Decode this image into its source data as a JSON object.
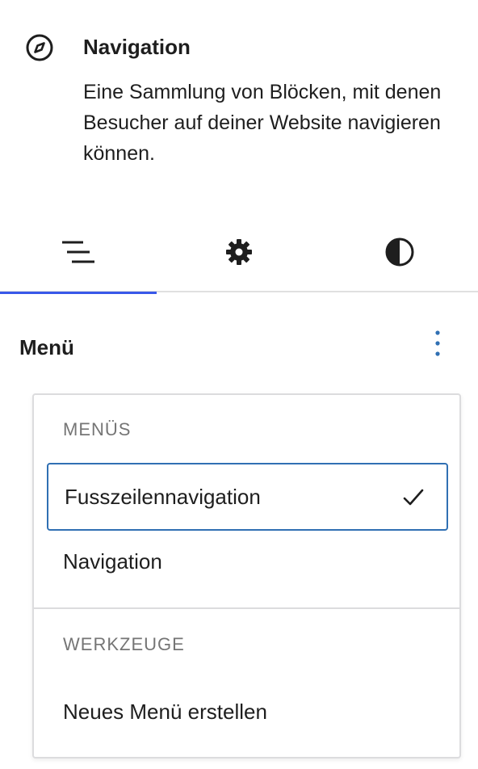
{
  "block": {
    "icon": "compass-icon",
    "title": "Navigation",
    "description": "Eine Sammlung von Blöcken, mit denen Besucher auf deiner Website navigieren können."
  },
  "tabs": [
    {
      "icon": "list-view-icon",
      "active": true
    },
    {
      "icon": "gear-icon",
      "active": false
    },
    {
      "icon": "contrast-icon",
      "active": false
    }
  ],
  "menu": {
    "title": "Menü",
    "options_icon": "more-vertical-icon"
  },
  "dropdown": {
    "menus_label": "MENÜS",
    "items": [
      {
        "label": "Fusszeilennavigation",
        "selected": true
      },
      {
        "label": "Navigation",
        "selected": false
      }
    ],
    "tools_label": "WERKZEUGE",
    "create_label": "Neues Menü erstellen"
  },
  "colors": {
    "accent": "#3858e9",
    "selected_border": "#3070b3",
    "text": "#1e1e1e",
    "muted": "#757575"
  }
}
